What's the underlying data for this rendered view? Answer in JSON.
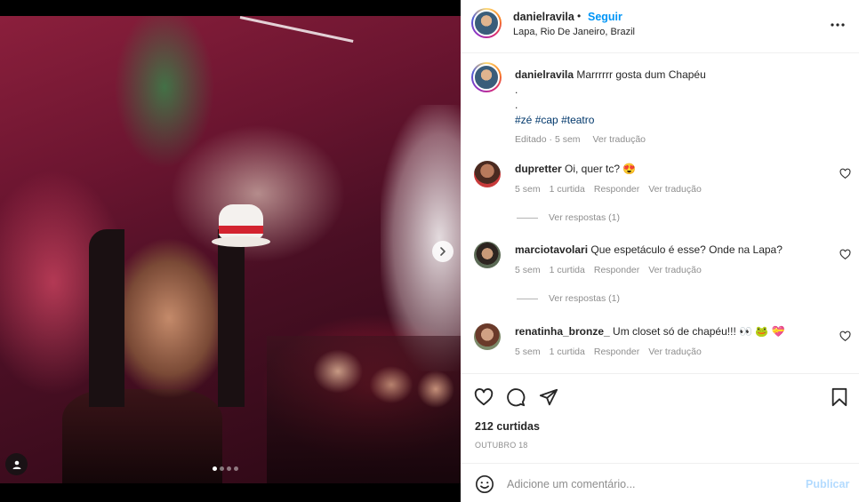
{
  "header": {
    "username": "danielravila",
    "separator": "•",
    "follow_label": "Seguir",
    "location": "Lapa, Rio De Janeiro, Brazil"
  },
  "caption": {
    "username": "danielravila",
    "text": "Marrrrrr gosta dum Chapéu",
    "line2": ".",
    "line3": ".",
    "hashtags": [
      "#zé",
      "#cap",
      "#teatro"
    ],
    "edited": "Editado · 5 sem",
    "translate": "Ver tradução"
  },
  "comments": [
    {
      "username": "dupretter",
      "text": "Oi, quer tc? 😍",
      "time": "5 sem",
      "likes": "1 curtida",
      "reply": "Responder",
      "translate": "Ver tradução",
      "replies": "Ver respostas (1)"
    },
    {
      "username": "marciotavolari",
      "text": "Que espetáculo é esse? Onde na Lapa?",
      "time": "5 sem",
      "likes": "1 curtida",
      "reply": "Responder",
      "translate": "Ver tradução",
      "replies": "Ver respostas (1)"
    },
    {
      "username": "renatinha_bronze_",
      "text": "Um closet só de chapéu!!! 👀 🐸 💝",
      "time": "5 sem",
      "likes": "1 curtida",
      "reply": "Responder",
      "translate": "Ver tradução"
    }
  ],
  "actions": {
    "likes": "212 curtidas",
    "date": "OUTUBRO 18"
  },
  "add_comment": {
    "placeholder": "Adicione um comentário...",
    "post_label": "Publicar"
  },
  "carousel": {
    "current": 1,
    "total": 4
  },
  "colors": {
    "accent": "#0095f6",
    "post_disabled": "#b3dbff",
    "hashtag": "#00376b",
    "muted": "#8e8e8e"
  },
  "icons": {
    "more": "more-horizontal-icon",
    "like": "heart-icon",
    "comment": "comment-bubble-icon",
    "share": "paper-plane-icon",
    "save": "bookmark-icon",
    "emoji": "emoji-smile-icon",
    "next": "chevron-right-icon",
    "tagged": "user-tag-icon"
  }
}
